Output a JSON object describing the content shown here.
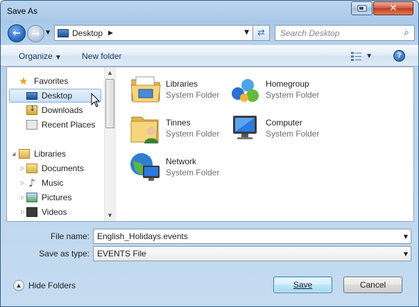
{
  "window": {
    "title": "Save As"
  },
  "address": {
    "location": "Desktop",
    "search_placeholder": "Search Desktop"
  },
  "toolbar": {
    "organize_label": "Organize",
    "new_folder_label": "New folder"
  },
  "navigation": {
    "favorites": [
      {
        "label": "Favorites",
        "icon": "star-icon"
      },
      {
        "label": "Desktop",
        "icon": "desktop-icon",
        "selected": true
      },
      {
        "label": "Downloads",
        "icon": "downloads-icon"
      },
      {
        "label": "Recent Places",
        "icon": "recent-places-icon"
      }
    ],
    "libraries": [
      {
        "label": "Libraries",
        "icon": "libraries-icon"
      },
      {
        "label": "Documents",
        "icon": "documents-icon"
      },
      {
        "label": "Music",
        "icon": "music-icon"
      },
      {
        "label": "Pictures",
        "icon": "pictures-icon"
      },
      {
        "label": "Videos",
        "icon": "videos-icon"
      }
    ]
  },
  "files": [
    {
      "name": "Libraries",
      "type": "System Folder",
      "icon": "libraries-folder-icon"
    },
    {
      "name": "Homegroup",
      "type": "System Folder",
      "icon": "homegroup-icon"
    },
    {
      "name": "Tinnes",
      "type": "System Folder",
      "icon": "user-folder-icon"
    },
    {
      "name": "Computer",
      "type": "System Folder",
      "icon": "computer-icon"
    },
    {
      "name": "Network",
      "type": "System Folder",
      "icon": "network-icon"
    }
  ],
  "form": {
    "file_name_label": "File name:",
    "file_name_value": "English_Holidays.events",
    "save_type_label": "Save as type:",
    "save_type_value": "EVENTS File"
  },
  "footer": {
    "hide_folders_label": "Hide Folders",
    "save_label": "Save",
    "cancel_label": "Cancel"
  }
}
